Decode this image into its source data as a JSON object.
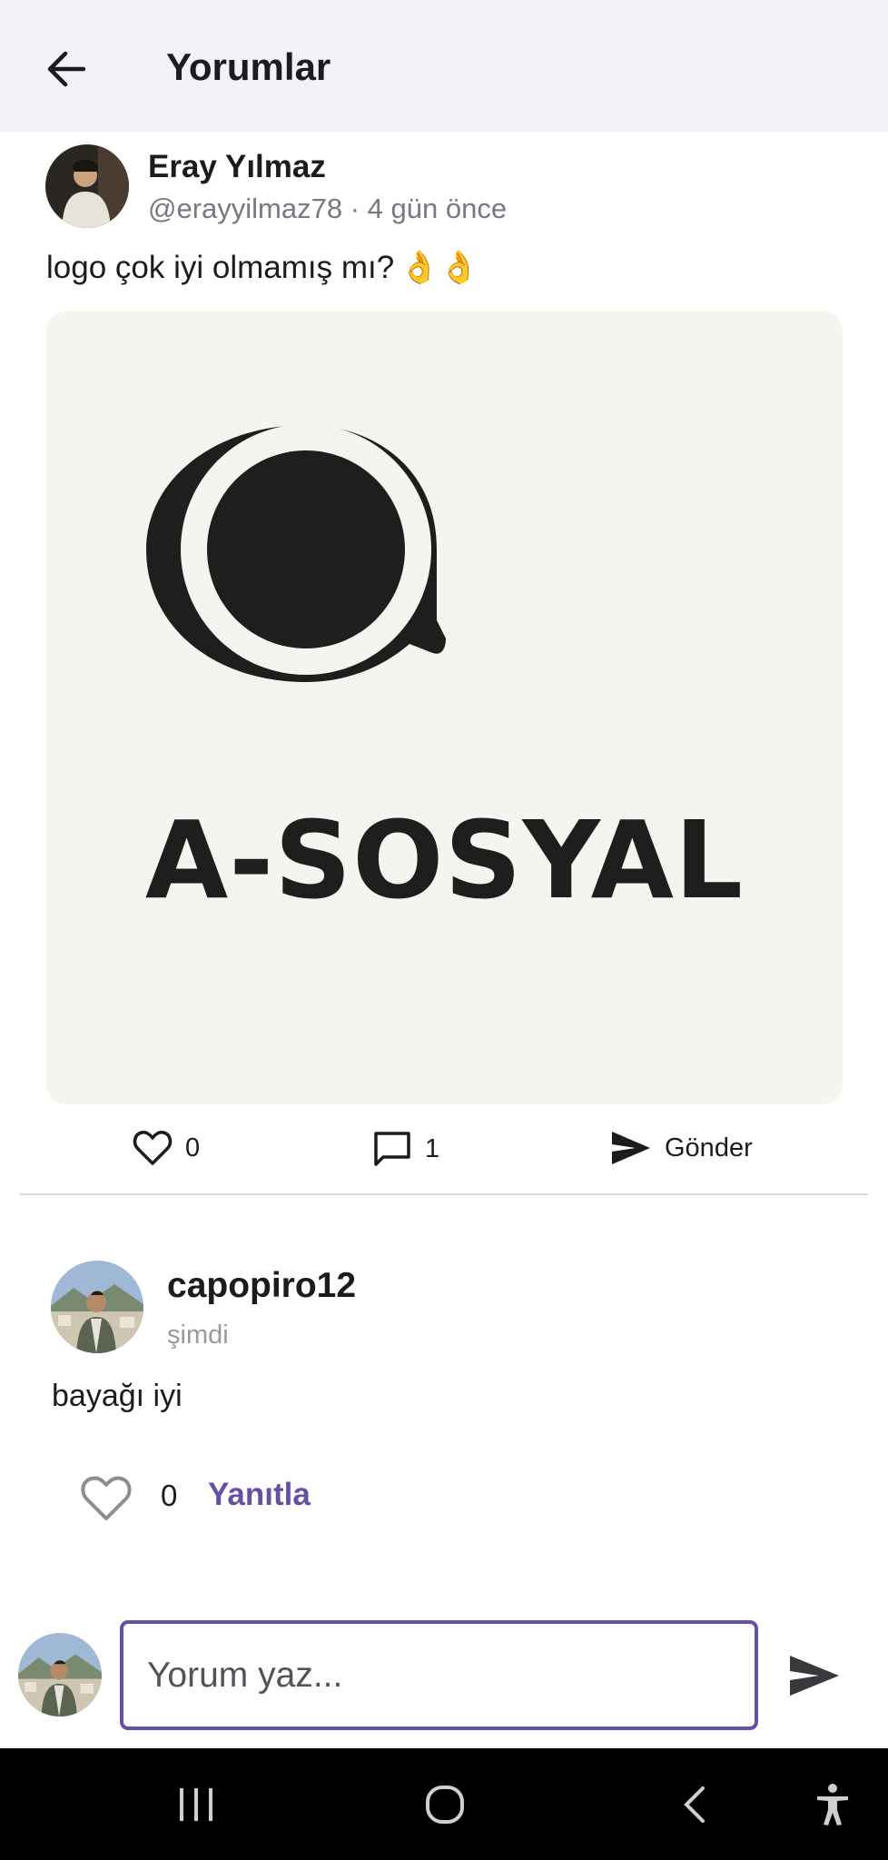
{
  "app_bar": {
    "title": "Yorumlar",
    "back_icon": "arrow-left-icon"
  },
  "post": {
    "author_name": "Eray Yılmaz",
    "author_handle": "@erayyilmaz78",
    "time_ago": "4 gün önce",
    "meta_separator": "·",
    "text": "logo çok iyi olmamış mı?",
    "emoji": "👌👌",
    "image_logo_text": "A-SOSYAL",
    "actions": {
      "like_count": "0",
      "comment_count": "1",
      "share_label": "Gönder"
    }
  },
  "comments": [
    {
      "username": "capopiro12",
      "time": "şimdi",
      "text": "bayağı iyi",
      "like_count": "0",
      "reply_label": "Yanıtla"
    }
  ],
  "composer": {
    "placeholder": "Yorum yaz..."
  },
  "colors": {
    "accent": "#6750a4",
    "app_bar_bg": "#f3f0f6",
    "image_bg": "#f6f4ef"
  }
}
